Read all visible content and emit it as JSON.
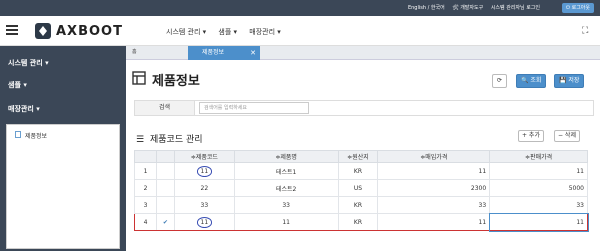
{
  "topbar": {
    "links": [
      "English / 한국어",
      "🛠 개발자도구",
      "시스템 관리자님 로그인"
    ],
    "logout": "⏻ 로그아웃"
  },
  "header": {
    "brand": "AXBOOT",
    "menu": [
      "시스템 관리 ▾",
      "샘플 ▾",
      "매장관리 ▾"
    ]
  },
  "sidebar": {
    "items": [
      "시스템 관리 ▾",
      "샘플 ▾",
      "매장관리 ▾"
    ],
    "sub_items": [
      "제품정보"
    ]
  },
  "tabs": {
    "home": "홈",
    "active": "제품정보"
  },
  "page": {
    "title": "제품정보",
    "buttons": {
      "refresh": "⟳",
      "search": "🔍 조회",
      "save": "💾 저장"
    },
    "search_label": "검색",
    "search_placeholder": "검색어를 입력하세요",
    "section_title": "제품코드 관리",
    "add_label": "+ 추가",
    "delete_label": "− 삭제"
  },
  "table": {
    "headers": [
      "",
      "",
      "≑제품코드",
      "≑제품명",
      "≑원산지",
      "≑매입가격",
      "≑판매가격"
    ],
    "rows": [
      [
        "1",
        "",
        "11",
        "테스트1",
        "KR",
        "11",
        "11"
      ],
      [
        "2",
        "",
        "22",
        "테스트2",
        "US",
        "2300",
        "5000"
      ],
      [
        "3",
        "",
        "33",
        "33",
        "KR",
        "33",
        "33"
      ],
      [
        "4",
        "✔",
        "11",
        "11",
        "KR",
        "11",
        "11"
      ]
    ]
  }
}
